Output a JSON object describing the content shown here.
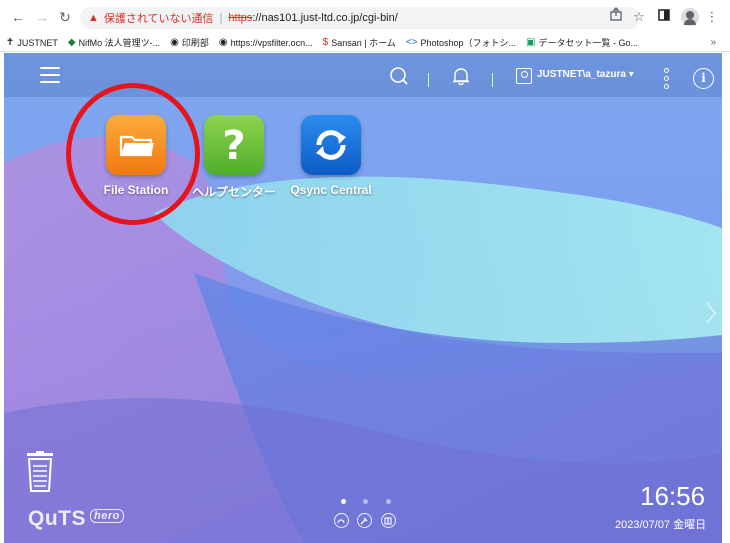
{
  "browser": {
    "url_warning": "保護されていない通信",
    "url_scheme": "https",
    "url_rest": "://nas101.just-ltd.co.jp/cgi-bin/",
    "bookmarks": [
      {
        "label": "JUSTNET"
      },
      {
        "label": "NifMo 法人管理ツ-..."
      },
      {
        "label": "印刷部"
      },
      {
        "label": "https://vpsfilter.ocn..."
      },
      {
        "label": "Sansan | ホーム"
      },
      {
        "label": "Photoshop（フォトシ..."
      },
      {
        "label": "データセット一覧 - Go..."
      }
    ],
    "more_bookmarks": "»"
  },
  "topbar": {
    "username": "JUSTNET\\a_tazura ▾"
  },
  "apps": [
    {
      "label": "File Station",
      "color": "#f58a1c"
    },
    {
      "label": "ヘルプセンター",
      "color": "#6cc13a"
    },
    {
      "label": "Qsync Central",
      "color": "#1a73d9"
    }
  ],
  "logo": {
    "name": "QuTS",
    "edition": "hero"
  },
  "clock": {
    "time": "16:56",
    "date": "2023/07/07 金曜日"
  },
  "colors": {
    "highlight_ring": "#e8141c",
    "warning": "#d93025"
  }
}
